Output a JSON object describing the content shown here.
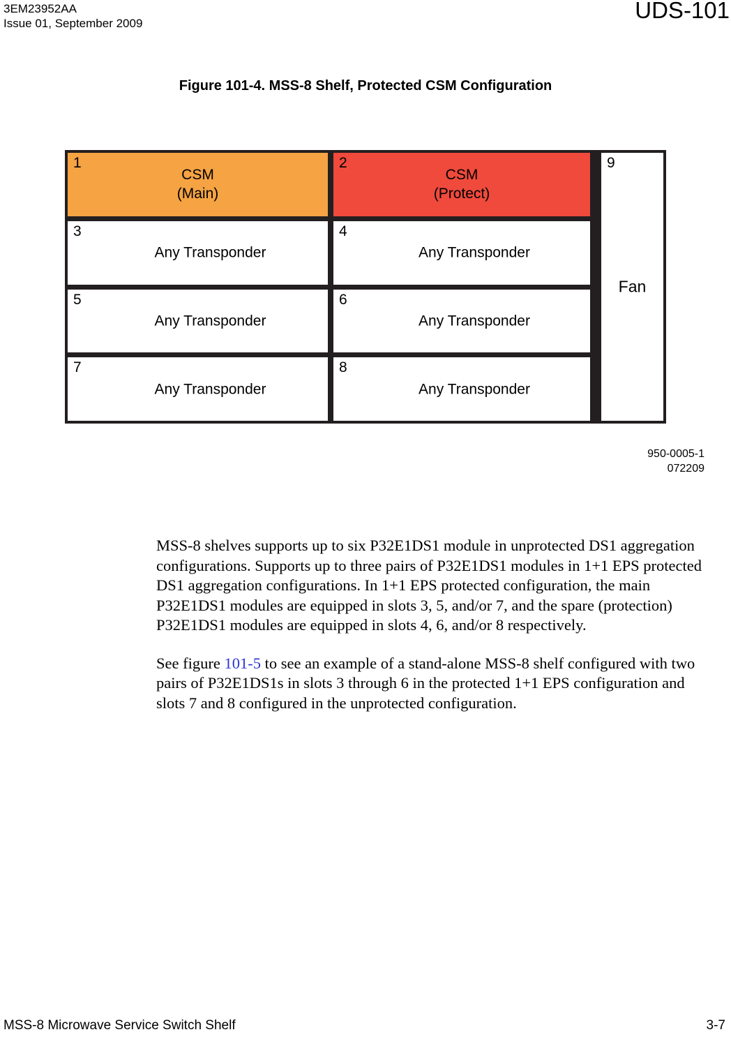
{
  "header": {
    "doc_id": "3EM23952AA",
    "issue": "Issue 01, September 2009",
    "section": "UDS-101"
  },
  "figure": {
    "caption": "Figure 101-4. MSS-8 Shelf, Protected CSM Configuration",
    "drawing_number": "950-0005-1",
    "drawing_date": "072209",
    "colors": {
      "csm_main": "#F5A343",
      "csm_protect": "#EF4A3C",
      "frame": "#231F20",
      "slot_background": "#FFFFFF"
    },
    "rows": [
      {
        "left": {
          "number": "1",
          "line1": "CSM",
          "line2": "(Main)",
          "fill": "csm_main"
        },
        "right": {
          "number": "2",
          "line1": "CSM",
          "line2": "(Protect)",
          "fill": "csm_protect"
        }
      },
      {
        "left": {
          "number": "3",
          "line1": "Any Transponder",
          "line2": "",
          "fill": "slot_background"
        },
        "right": {
          "number": "4",
          "line1": "Any Transponder",
          "line2": "",
          "fill": "slot_background"
        }
      },
      {
        "left": {
          "number": "5",
          "line1": "Any Transponder",
          "line2": "",
          "fill": "slot_background"
        },
        "right": {
          "number": "6",
          "line1": "Any Transponder",
          "line2": "",
          "fill": "slot_background"
        }
      },
      {
        "left": {
          "number": "7",
          "line1": "Any Transponder",
          "line2": "",
          "fill": "slot_background"
        },
        "right": {
          "number": "8",
          "line1": "Any Transponder",
          "line2": "",
          "fill": "slot_background"
        }
      }
    ],
    "fan_slot": {
      "number": "9",
      "label": "Fan"
    }
  },
  "body": {
    "paragraph_1": "MSS-8 shelves supports up to six P32E1DS1 module in unprotected DS1 aggregation configurations. Supports up to three pairs of P32E1DS1 modules in 1+1 EPS protected DS1 aggregation configurations. In 1+1 EPS protected configuration, the main P32E1DS1 modules are equipped in slots 3, 5, and/or 7, and the spare (protection) P32E1DS1 modules are equipped in slots 4, 6, and/or 8 respectively.",
    "paragraph_2_before": "See figure ",
    "paragraph_2_link": "101-5",
    "paragraph_2_after": " to see an example of a stand-alone MSS-8 shelf configured with two pairs of P32E1DS1s in slots 3 through 6 in the protected 1+1 EPS configuration and slots 7 and 8 configured in the unprotected configuration."
  },
  "footer": {
    "title": "MSS-8 Microwave Service Switch Shelf",
    "page_number": "3-7"
  }
}
